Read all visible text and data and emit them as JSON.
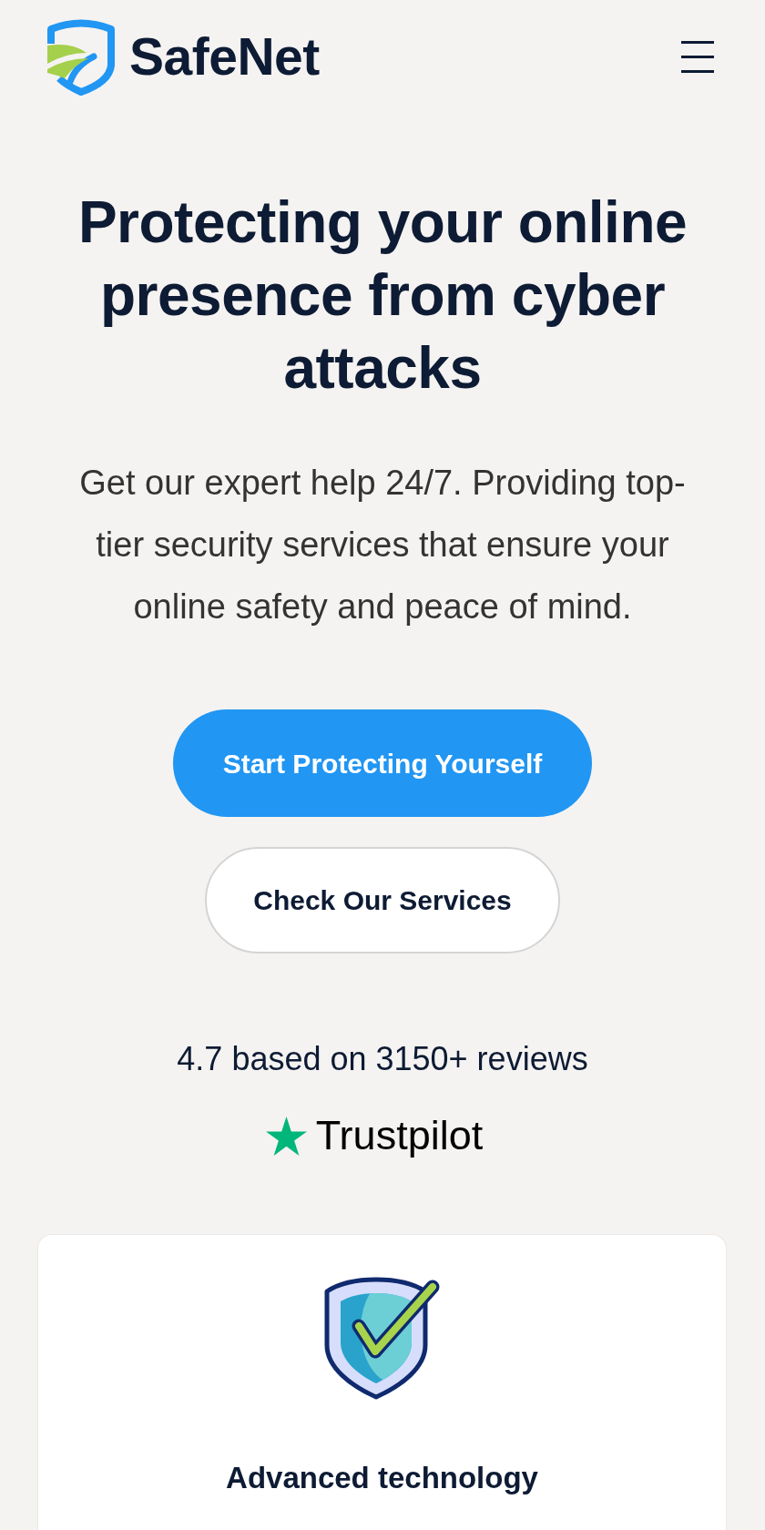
{
  "header": {
    "logo_text": "SafeNet"
  },
  "hero": {
    "title": "Protecting your online presence from cyber attacks",
    "subtitle": "Get our expert help 24/7. Providing top-tier security services that ensure your online safety and peace of mind.",
    "buttons": [
      {
        "label": "Start Protecting Yourself",
        "kind": "primary"
      },
      {
        "label": "Check Our Services",
        "kind": "secondary"
      }
    ]
  },
  "rating": {
    "summary": "4.7 based on 3150+ reviews",
    "brand": "Trustpilot"
  },
  "features": [
    {
      "title": "Advanced technology"
    }
  ]
}
